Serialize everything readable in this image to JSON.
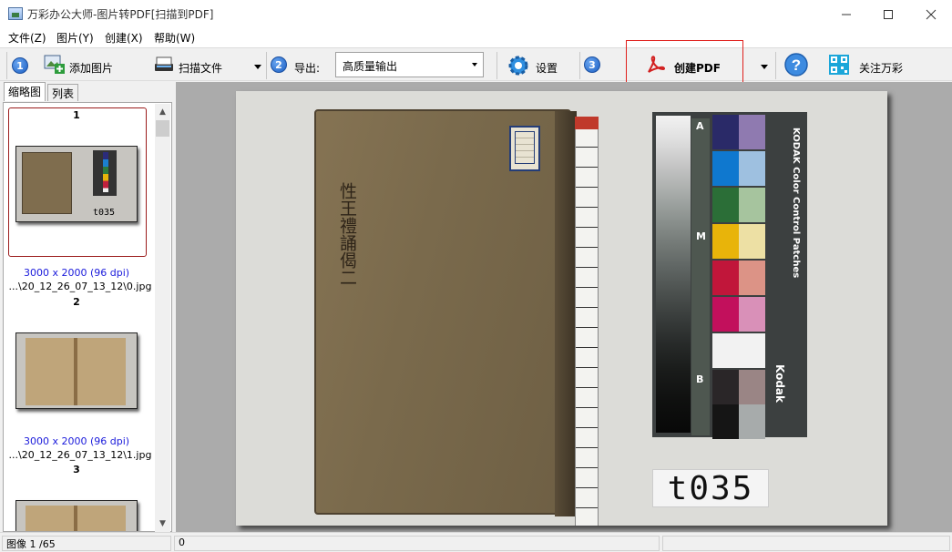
{
  "window": {
    "title": "万彩办公大师-图片转PDF[扫描到PDF]",
    "min_icon": "minimize-icon",
    "max_icon": "maximize-icon",
    "close_icon": "close-icon"
  },
  "menu": [
    {
      "label": "文件(Z)"
    },
    {
      "label": "图片(Y)"
    },
    {
      "label": "创建(X)"
    },
    {
      "label": "帮助(W)"
    }
  ],
  "toolbar": {
    "step1": "1",
    "add_images": "添加图片",
    "scan_file": "扫描文件",
    "step2": "2",
    "export_label": "导出:",
    "export_value": "高质量输出",
    "settings": "设置",
    "step3": "3",
    "create_pdf": "创建PDF",
    "follow": "关注万彩",
    "accent_red": "#e0201c"
  },
  "left_panel": {
    "tabs": [
      {
        "label": "缩略图"
      },
      {
        "label": "列表"
      }
    ],
    "thumbnails": [
      {
        "num": "1",
        "info": "3000 x 2000 (96 dpi)",
        "file": "...\\20_12_26_07_13_12\\0.jpg",
        "selected": true
      },
      {
        "num": "2",
        "info": "3000 x 2000 (96 dpi)",
        "file": "...\\20_12_26_07_13_12\\1.jpg",
        "selected": false
      },
      {
        "num": "3",
        "info": "",
        "file": "",
        "selected": false
      }
    ],
    "thumb1_label": "t035"
  },
  "preview": {
    "target_label": "t035",
    "book_title": "性王禮誦偈二",
    "chart_text": "KODAK Color Control Patches",
    "chart_brand": "Kodak",
    "gray_letters": [
      "A",
      "M",
      "B"
    ]
  },
  "status": {
    "image_index": "图像 1 /65",
    "value": "0"
  }
}
